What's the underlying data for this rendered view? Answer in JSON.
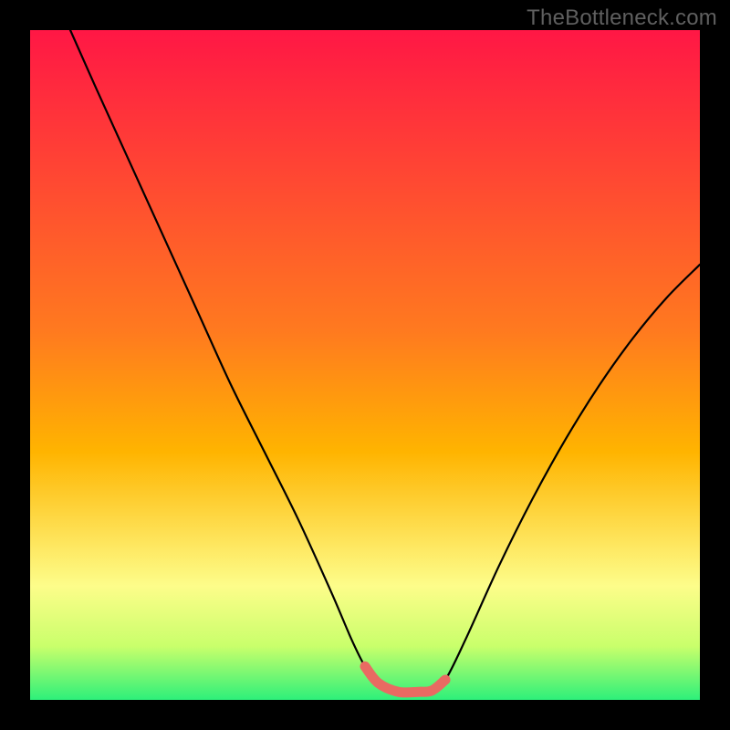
{
  "watermark": "TheBottleneck.com",
  "colors": {
    "frame": "#000000",
    "curve": "#000000",
    "accent": "#e96a62",
    "grad_top": "#ff1745",
    "grad_mid": "#ffb400",
    "grad_low": "#fdfd8a",
    "grad_bottom": "#2df07a"
  },
  "chart_data": {
    "type": "line",
    "title": "",
    "xlabel": "",
    "ylabel": "",
    "xlim": [
      0,
      100
    ],
    "ylim": [
      0,
      100
    ],
    "series": [
      {
        "name": "curve",
        "x": [
          6,
          10,
          15,
          20,
          25,
          30,
          35,
          40,
          45,
          48,
          50,
          52,
          55,
          58,
          60,
          62,
          65,
          70,
          75,
          80,
          85,
          90,
          95,
          100
        ],
        "y": [
          100,
          91,
          80,
          69,
          58,
          47,
          37,
          27,
          16,
          9,
          5,
          2.5,
          1.2,
          1.2,
          1.4,
          3,
          9,
          20,
          30,
          39,
          47,
          54,
          60,
          65
        ]
      },
      {
        "name": "accent-flat",
        "x": [
          50,
          52,
          55,
          58,
          60,
          62
        ],
        "y": [
          5,
          2.5,
          1.2,
          1.2,
          1.4,
          3
        ]
      }
    ],
    "gradient_stops_pct": [
      0,
      45,
      78,
      88,
      94,
      100
    ]
  }
}
